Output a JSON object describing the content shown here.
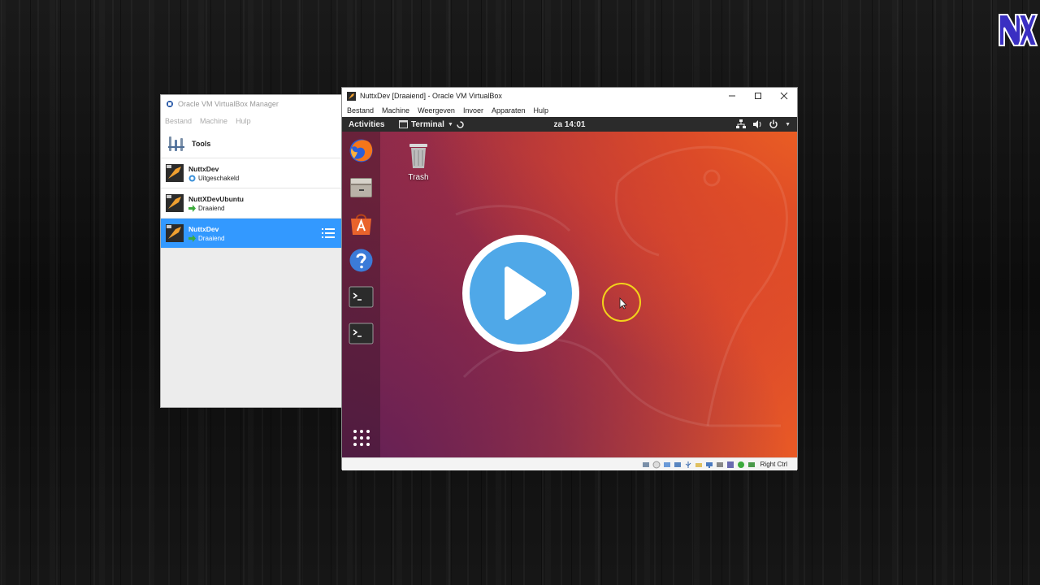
{
  "manager": {
    "title": "Oracle VM VirtualBox Manager",
    "menu": [
      "Bestand",
      "Machine",
      "Hulp"
    ],
    "tools_label": "Tools",
    "vms": [
      {
        "name": "NuttxDev",
        "state": "Uitgeschakeld"
      },
      {
        "name": "NuttXDevUbuntu",
        "state": "Draaiend"
      },
      {
        "name": "NuttxDev",
        "state": "Draaiend"
      }
    ]
  },
  "vm_window": {
    "title": "NuttxDev [Draaiend] - Oracle VM VirtualBox",
    "menu": [
      "Bestand",
      "Machine",
      "Weergeven",
      "Invoer",
      "Apparaten",
      "Hulp"
    ],
    "host_key": "Right Ctrl"
  },
  "guest": {
    "activities": "Activities",
    "app_menu": "Terminal",
    "clock": "za 14:01",
    "trash_label": "Trash",
    "dock_apps": [
      "firefox-icon",
      "files-icon",
      "software-center-icon",
      "help-icon",
      "terminal-icon",
      "terminal-icon"
    ]
  },
  "colors": {
    "selection": "#3399ff",
    "play_button": "#4fa8e8",
    "ubuntu_orange": "#e95420",
    "ubuntu_aubergine": "#5e1f57"
  }
}
